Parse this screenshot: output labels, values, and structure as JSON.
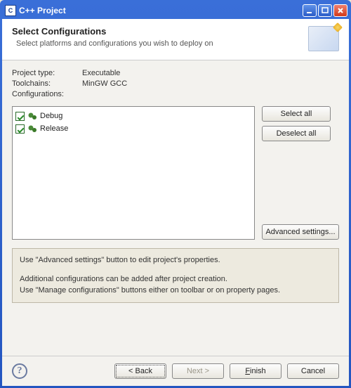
{
  "title": "C++ Project",
  "header": {
    "title": "Select Configurations",
    "subtitle": "Select platforms and configurations you wish to deploy on"
  },
  "props": {
    "projectTypeLabel": "Project type:",
    "projectType": "Executable",
    "toolchainsLabel": "Toolchains:",
    "toolchains": "MinGW GCC",
    "configsLabel": "Configurations:"
  },
  "configs": [
    {
      "label": "Debug",
      "checked": true
    },
    {
      "label": "Release",
      "checked": true
    }
  ],
  "buttons": {
    "selectAll": "Select all",
    "deselectAll": "Deselect all",
    "advanced": "Advanced settings...",
    "back": "< Back",
    "next": "Next >",
    "finish": "Finish",
    "cancel": "Cancel"
  },
  "notes": {
    "line1": "Use \"Advanced settings\" button to edit project's properties.",
    "line2": "Additional configurations can be added after project creation.",
    "line3": "Use \"Manage configurations\" buttons either on toolbar or on property pages."
  }
}
